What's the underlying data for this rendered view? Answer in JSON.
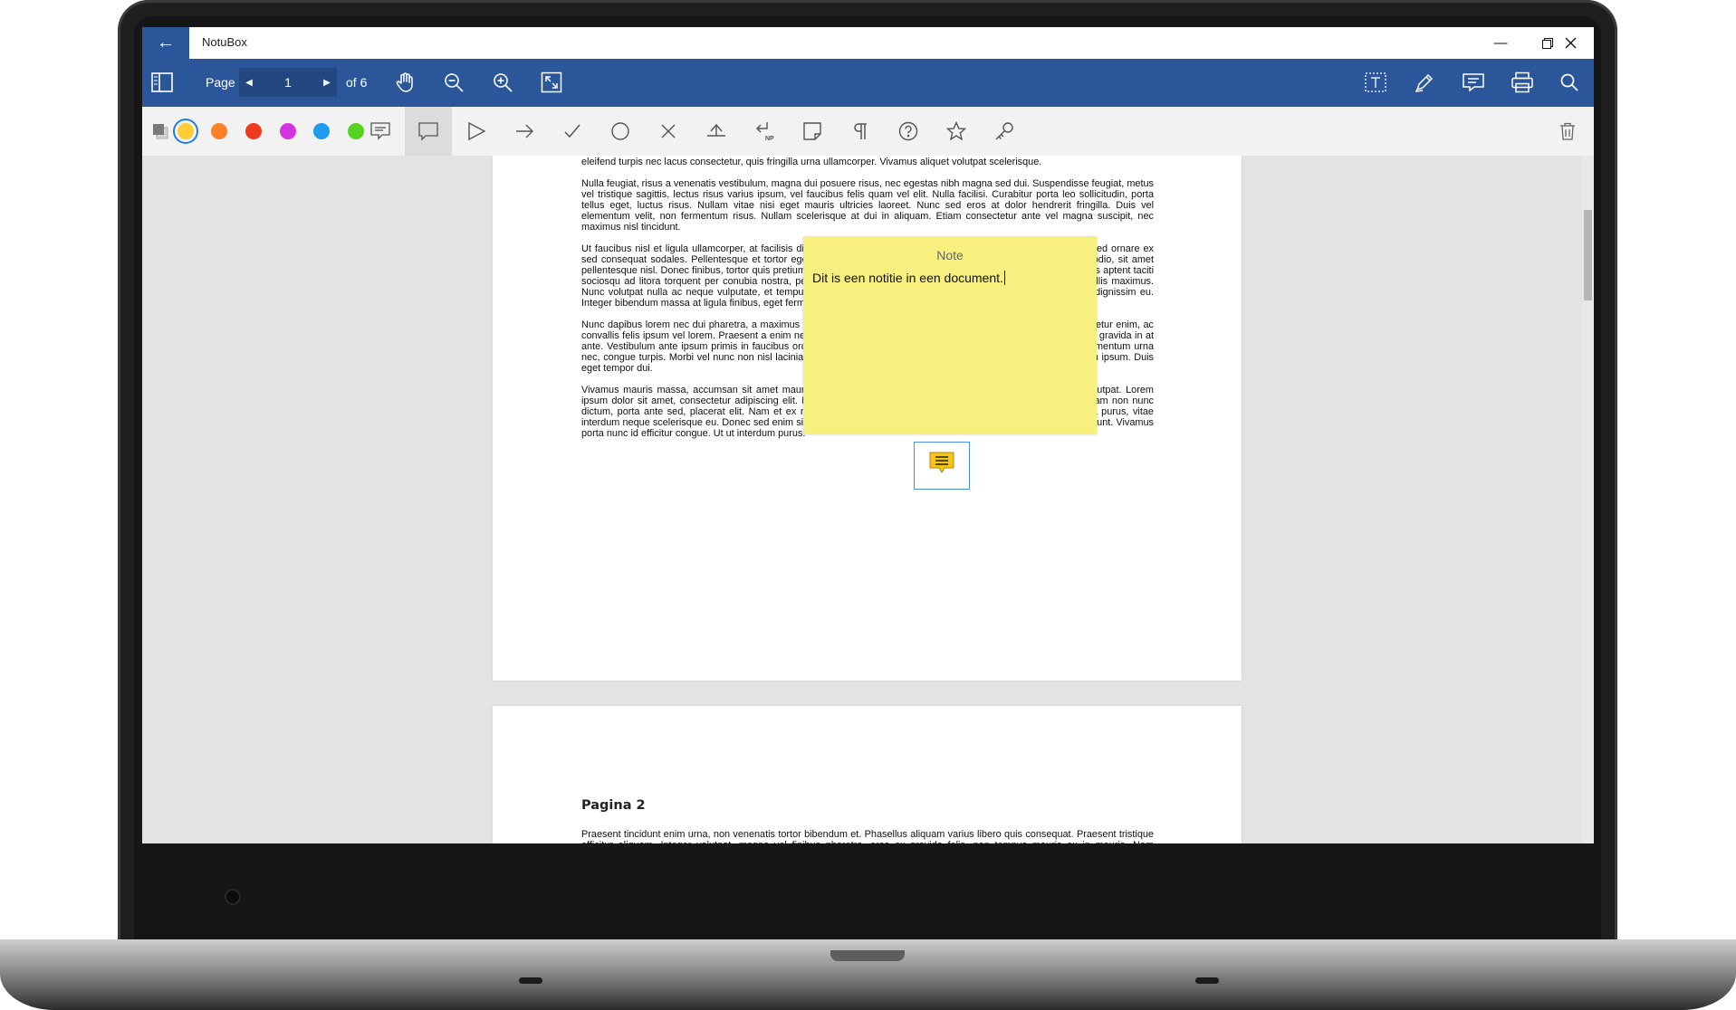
{
  "window": {
    "title": "NotuBox"
  },
  "toolbar": {
    "page_label": "Page",
    "page_value": "1",
    "page_total": "of 6"
  },
  "annotation_colors": [
    "#ffcc33",
    "#ff7f27",
    "#ee3b1f",
    "#d334e0",
    "#1e9aef",
    "#55d322"
  ],
  "accent_color": "#2b579a",
  "document": {
    "page1_paragraphs": [
      "eleifend turpis nec lacus consectetur, quis fringilla urna ullamcorper. Vivamus aliquet volutpat scelerisque.",
      "Nulla feugiat, risus a venenatis vestibulum, magna dui posuere risus, nec egestas nibh magna sed dui. Suspendisse feugiat, metus vel tristique sagittis, lectus risus varius ipsum, vel faucibus felis quam vel elit. Nulla facilisi. Curabitur porta leo sollicitudin, porta tellus eget, luctus risus. Nullam vitae nisi eget mauris ultricies laoreet. Nunc sed eros at dolor hendrerit fringilla. Duis vel elementum velit, non fermentum risus. Nullam scelerisque at dui in aliquam. Etiam consectetur ante vel magna suscipit, nec maximus nisl tincidunt.",
      "Ut faucibus nisl et ligula ullamcorper, at facilisis diam fermentum. Integer vitae pretium turpis vel iaculis hendrerit. Sed ornare ex sed consequat sodales. Pellentesque et tortor eget ante tempor bibendum. Suspendisse potenti. Donec a dictum odio, sit amet pellentesque nisl. Donec finibus, tortor quis pretium tristique, nulla felis congue lorem, non dapibus nunc urna in. Class aptent taciti sociosqu ad litora torquent per conubia nostra, per inceptos himenaeos. Vestibulum id luctus nisi. Fusce eu convallis maximus. Nunc volutpat nulla ac neque vulputate, et tempus libero sagittis. Sed vitae nibh nec massa ornare iaculis in orci dignissim eu. Integer bibendum massa at ligula finibus, eget fermentum metus tincidunt.",
      "Nunc dapibus lorem nec dui pharetra, a maximus tortor facilisis. Aliquam at massa scelerisque, mauris justo consectetur enim, ac convallis felis ipsum vel lorem. Praesent a enim nec turpis congue tincidunt at quis nisi. Nulla lorem et ligula tincidunt gravida in at ante. Vestibulum ante ipsum primis in faucibus orci luctus et ultrices posuere cubilia Curae; Duis id nisi fringilla, elementum urna nec, congue turpis. Morbi vel nunc non nisl lacinia porttitor a et dolor. Sed magna molestie, eleifend tellus eu, dictum ipsum. Duis eget tempor dui.",
      "Vivamus mauris massa, accumsan sit amet mauris nec, laoreet pharetra nisi. Quisque venenatis vel lectus ac volutpat. Lorem ipsum dolor sit amet, consectetur adipiscing elit. Phasellus ut metus turpis. Nunc feugiat rutrum felis quis porta. Nam non nunc dictum, porta ante sed, placerat elit. Nam et ex nec libero dictum tempor pulvinar id metus. Donec feugiat magna purus, vitae interdum neque scelerisque eu. Donec sed enim sit amet neque congue fermentum a et nibh. Ut sagittis gravida tincidunt. Vivamus porta nunc id efficitur congue. Ut ut interdum purus."
    ],
    "page2_heading": "Pagina 2",
    "page2_paragraph": "Praesent tincidunt enim urna, non venenatis tortor bibendum et. Phasellus aliquam varius libero quis consequat. Praesent tristique efficitur aliquam. Integer volutpat, magna vel finibus pharetra, eros ex gravida felis, non tempus mauris ex in mauris. Nam accumsan nisl sed tellus rhoncus tempus. Nulla fermentum erat arcu, at tempus arcu tempus vitae."
  },
  "note": {
    "title": "Note",
    "text": "Dit is een notitie in een document."
  }
}
